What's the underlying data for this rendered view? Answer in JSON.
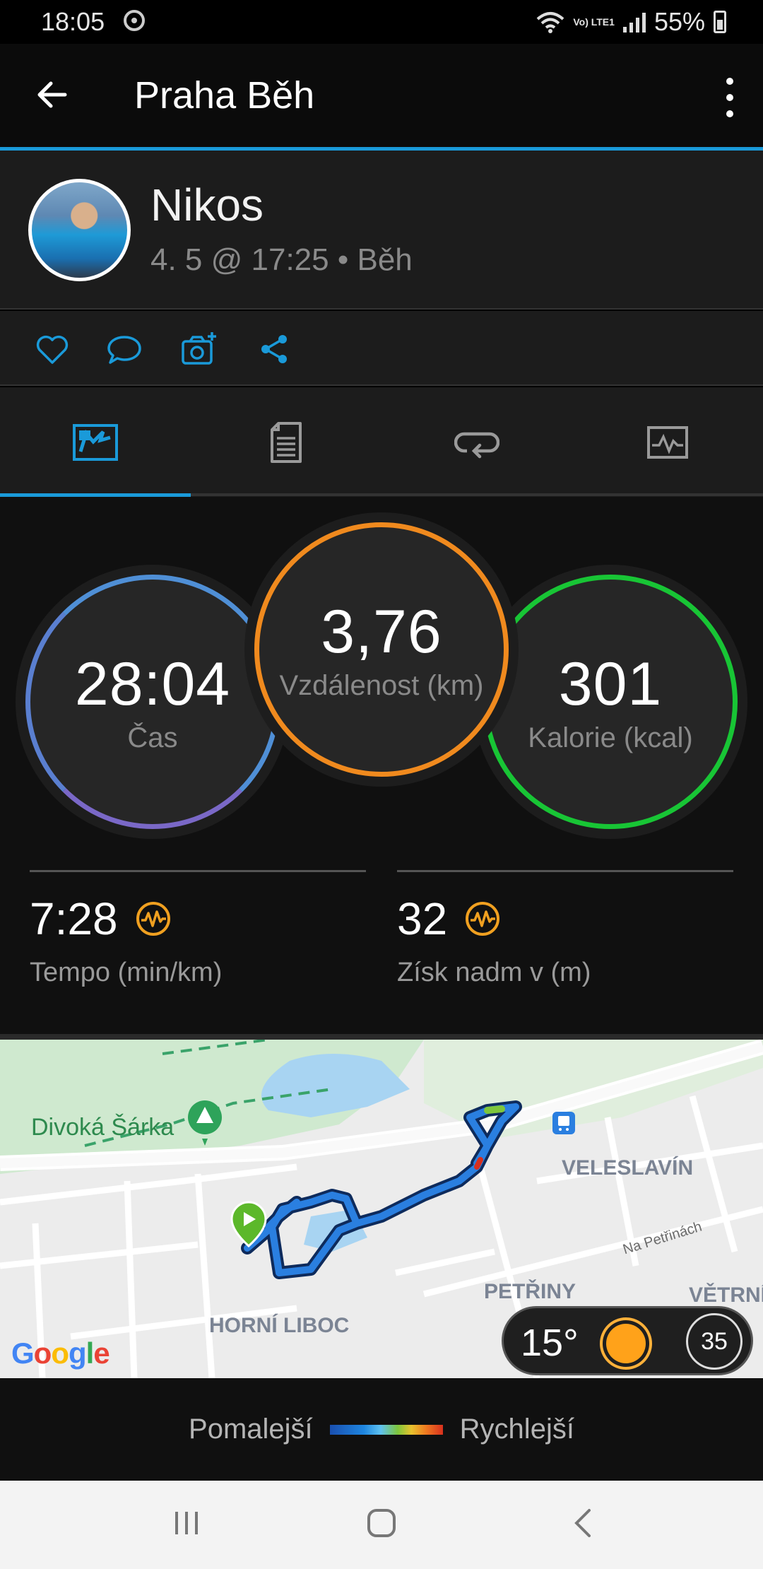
{
  "status_bar": {
    "time": "18:05",
    "network_label": "Vo) LTE1",
    "battery": "55%"
  },
  "app_bar": {
    "title": "Praha Běh"
  },
  "activity": {
    "user_name": "Nikos",
    "meta": "4. 5 @ 17:25 • Běh"
  },
  "actions": [
    "heart-icon",
    "comment-icon",
    "add-photo-icon",
    "share-icon"
  ],
  "tabs": [
    {
      "icon": "overview-icon",
      "active": true
    },
    {
      "icon": "details-icon",
      "active": false
    },
    {
      "icon": "laps-icon",
      "active": false
    },
    {
      "icon": "charts-icon",
      "active": false
    }
  ],
  "stats": {
    "time": {
      "value": "28:04",
      "label": "Čas",
      "color": "#4f8fd6"
    },
    "distance": {
      "value": "3,76",
      "label": "Vzdálenost (km)",
      "color": "#f08a1e"
    },
    "calories": {
      "value": "301",
      "label": "Kalorie (kcal)",
      "color": "#18c535"
    },
    "pace": {
      "value": "7:28",
      "label": "Tempo (min/km)"
    },
    "elevation": {
      "value": "32",
      "label": "Získ nadm v (m)"
    }
  },
  "map": {
    "labels": {
      "park": "Divoká Šárka",
      "district1": "VELESLAVÍN",
      "district2": "PETŘINY",
      "district3": "VĚTRNÍ",
      "district4": "HORNÍ LIBOC",
      "street": "Na Petřinách"
    },
    "google": "Google",
    "weather": {
      "temp": "15°",
      "wind": "35"
    }
  },
  "legend": {
    "slower": "Pomalejší",
    "faster": "Rychlejší"
  }
}
